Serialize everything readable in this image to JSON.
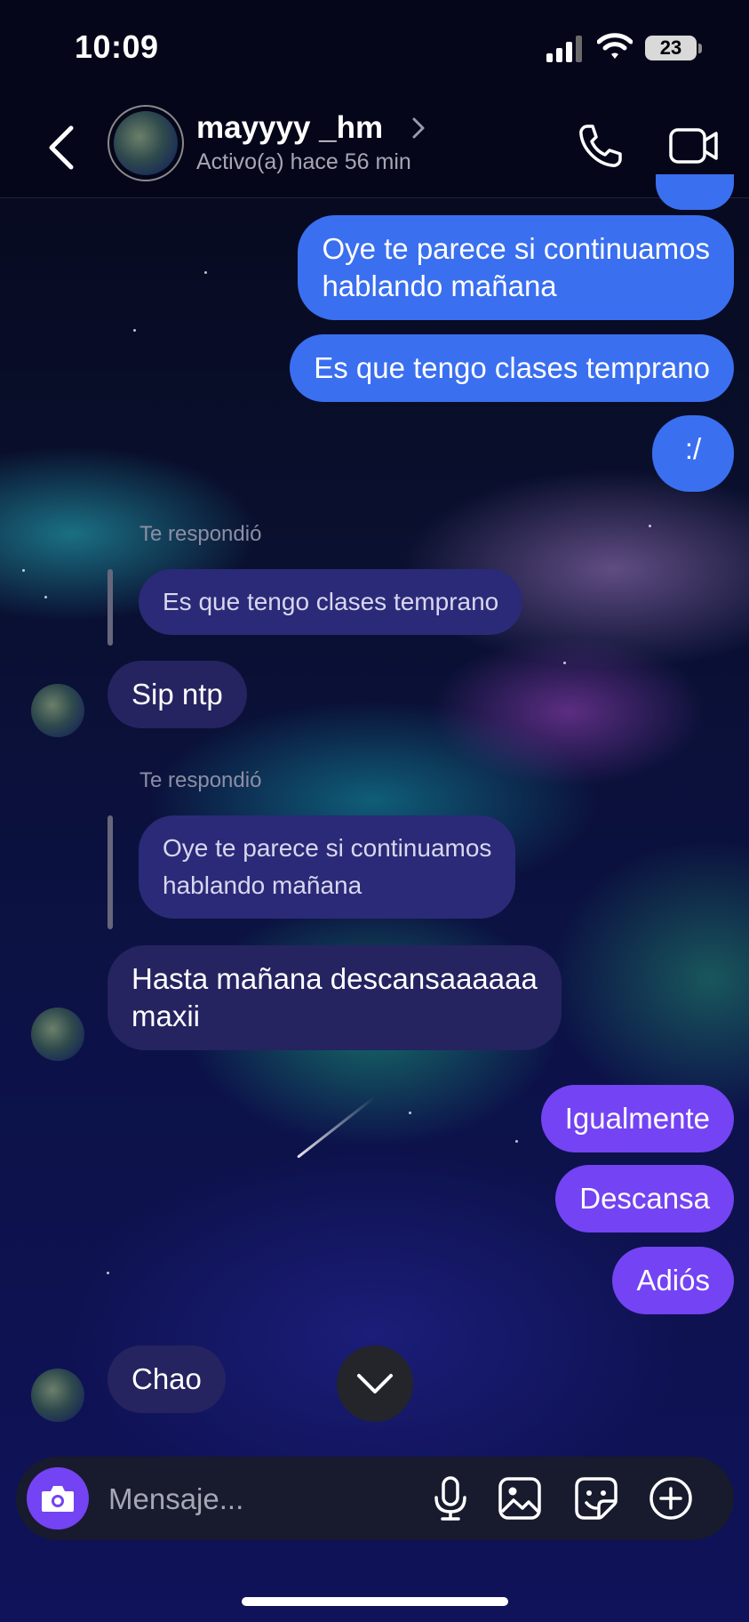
{
  "status_bar": {
    "time": "10:09",
    "battery": "23"
  },
  "header": {
    "username": "mayyyy _hm",
    "activity": "Activo(a) hace 56 min"
  },
  "messages": [
    {
      "from": "me",
      "text": "Oye te parece si continuamos\nhablando mañana"
    },
    {
      "from": "me",
      "text": "Es que tengo clases temprano"
    },
    {
      "from": "me",
      "text": ":/"
    },
    {
      "from": "them",
      "reply_label": "Te respondió",
      "quoted": "Es que tengo clases temprano",
      "text": "Sip ntp"
    },
    {
      "from": "them",
      "reply_label": "Te respondió",
      "quoted": "Oye te parece si continuamos\nhablando mañana",
      "text": "Hasta mañana descansaaaaaa\nmaxii"
    },
    {
      "from": "me",
      "text": "Igualmente"
    },
    {
      "from": "me",
      "text": "Descansa"
    },
    {
      "from": "me",
      "text": "Adiós"
    },
    {
      "from": "them",
      "text": "Chao"
    }
  ],
  "composer": {
    "placeholder": "Mensaje..."
  },
  "colors": {
    "sent_blue": "#3a6ff0",
    "sent_purple": "#7443f3",
    "received": "#252360",
    "quoted": "#2b2a78"
  },
  "icons": [
    "back-icon",
    "chevron-right-icon",
    "phone-icon",
    "video-icon",
    "camera-icon",
    "microphone-icon",
    "image-icon",
    "sticker-icon",
    "plus-icon",
    "chevron-down-icon"
  ]
}
